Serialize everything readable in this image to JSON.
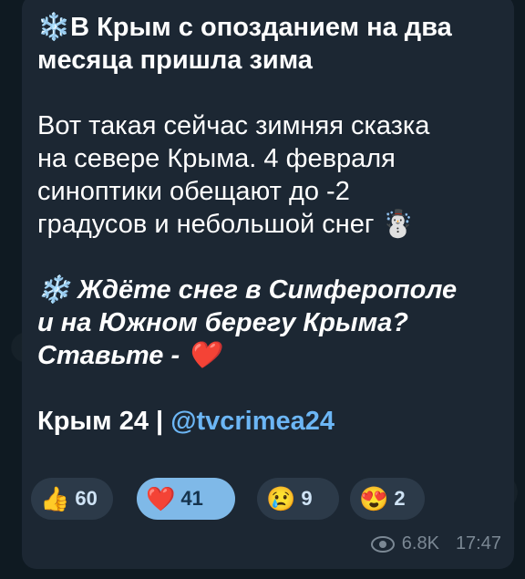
{
  "post": {
    "title_emoji": "❄️",
    "title": "В Крым с опозданием на два месяца пришла зима",
    "body_lines": [
      "Вот такая сейчас зимняя сказка",
      "на севере Крыма. 4 февраля",
      "синоптики обещают до -2",
      "градусов и небольшой снег"
    ],
    "body_emoji": "☃️",
    "question_emoji": "❄️",
    "question_lines": [
      "Ждёте снег в Симферополе",
      "и на Южном берегу Крыма?",
      "Ставьте -"
    ],
    "question_heart": "❤️",
    "channel_name": "Крым 24 |",
    "channel_link": "@tvcrimea24"
  },
  "reactions": [
    {
      "emoji": "👍",
      "count": "60",
      "active": false
    },
    {
      "emoji": "❤️",
      "count": "41",
      "active": true
    },
    {
      "emoji": "😢",
      "count": "9",
      "active": false
    },
    {
      "emoji": "😍",
      "count": "2",
      "active": false
    }
  ],
  "meta": {
    "views": "6.8K",
    "time": "17:47"
  }
}
